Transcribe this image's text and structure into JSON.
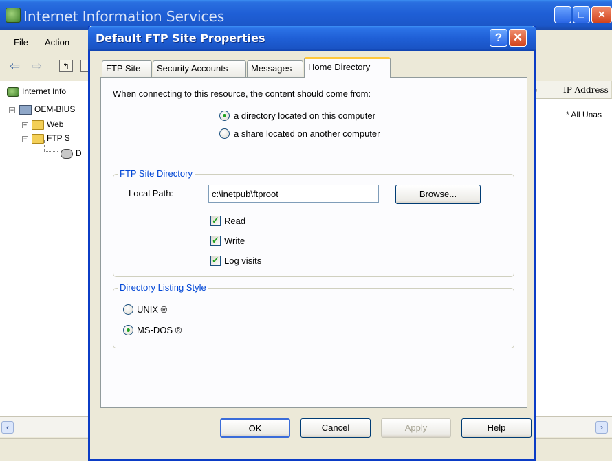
{
  "main_window": {
    "title": "Internet Information Services",
    "menu": [
      "File",
      "Action"
    ],
    "tree": {
      "root": "Internet Info",
      "computer": "OEM-BIUS",
      "web": "Web",
      "ftp": "FTP S",
      "default": "D"
    },
    "list": {
      "col_name_tail": "e",
      "col_ip": "IP Address",
      "ip_value": "* All Unas"
    }
  },
  "dialog": {
    "title": "Default FTP Site Properties",
    "tabs": [
      "FTP Site",
      "Security Accounts",
      "Messages",
      "Home Directory"
    ],
    "active_tab": "Home Directory",
    "intro": "When connecting to this resource, the content should come from:",
    "source_options": [
      {
        "label": "a directory located on this computer",
        "checked": true
      },
      {
        "label": "a share located on another computer",
        "checked": false
      }
    ],
    "ftp_site_directory": {
      "title": "FTP Site Directory",
      "local_path_label": "Local Path:",
      "local_path_value": "c:\\inetpub\\ftproot",
      "browse_label": "Browse...",
      "permissions": [
        {
          "label": "Read",
          "checked": true
        },
        {
          "label": "Write",
          "checked": true
        },
        {
          "label": "Log visits",
          "checked": true
        }
      ]
    },
    "directory_listing_style": {
      "title": "Directory Listing Style",
      "options": [
        {
          "label": "UNIX ®",
          "checked": false
        },
        {
          "label": "MS-DOS ®",
          "checked": true
        }
      ]
    },
    "buttons": {
      "ok": "OK",
      "cancel": "Cancel",
      "apply": "Apply",
      "help": "Help"
    }
  },
  "colors": {
    "title_blue": "#1f5fd6",
    "group_title": "#0046d5",
    "check_green": "#21a121",
    "dialog_bg": "#ece9d8"
  }
}
